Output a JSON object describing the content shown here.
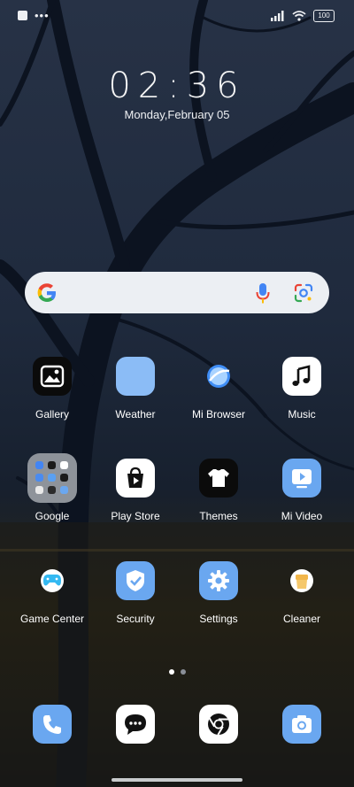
{
  "status_bar": {
    "battery": "100"
  },
  "clock": {
    "time": "02:36",
    "date": "Monday,February 05"
  },
  "apps": [
    {
      "label": "Gallery"
    },
    {
      "label": "Weather"
    },
    {
      "label": "Mi Browser"
    },
    {
      "label": "Music"
    },
    {
      "label": "Google"
    },
    {
      "label": "Play Store"
    },
    {
      "label": "Themes"
    },
    {
      "label": "Mi Video"
    },
    {
      "label": "Game Center"
    },
    {
      "label": "Security"
    },
    {
      "label": "Settings"
    },
    {
      "label": "Cleaner"
    }
  ],
  "dock": [
    "Phone",
    "Messaging",
    "Chrome",
    "Camera"
  ],
  "page_indicator": {
    "pages": 2,
    "current": 1
  },
  "colors": {
    "accent_blue": "#6aa7f0",
    "search_bg": "#eceff3"
  }
}
